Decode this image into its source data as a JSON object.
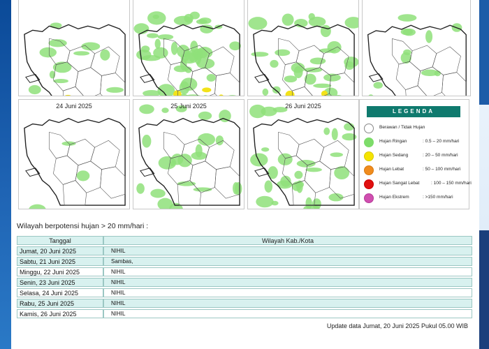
{
  "maps": [
    {
      "id": "map-1",
      "title": ""
    },
    {
      "id": "map-2",
      "title": ""
    },
    {
      "id": "map-3",
      "title": ""
    },
    {
      "id": "map-4",
      "title": ""
    },
    {
      "id": "map-5",
      "title": "24 Juni 2025"
    },
    {
      "id": "map-6",
      "title": "25 Juni 2025"
    },
    {
      "id": "map-7",
      "title": "26 Juni 2025"
    }
  ],
  "legend": {
    "title": "LEGENDA",
    "items": [
      {
        "label": "Berawan / Tidak Hujan",
        "range": "",
        "color": "#ffffff"
      },
      {
        "label": "Hujan Ringan",
        "range": ": 0.5 – 20 mm/hari",
        "color": "#7ddc6a"
      },
      {
        "label": "Hujan Sedang",
        "range": ": 20 – 50 mm/hari",
        "color": "#f5e400"
      },
      {
        "label": "Hujan Lebat",
        "range": ": 50 – 100 mm/hari",
        "color": "#f08c1e"
      },
      {
        "label": "Hujan Sangat Lebat",
        "range": ": 100 – 150 mm/hari",
        "color": "#e01010"
      },
      {
        "label": "Hujan Ekstrem",
        "range": ": >150 mm/hari",
        "color": "#d04fb0"
      }
    ]
  },
  "caption": "Wilayah berpotensi hujan > 20 mm/hari :",
  "table": {
    "headers": [
      "Tanggal",
      "Wilayah Kab./Kota"
    ],
    "rows": [
      [
        "Jumat, 20 Juni 2025",
        "NIHIL"
      ],
      [
        "Sabtu, 21 Juni 2025",
        "Sambas,"
      ],
      [
        "Minggu, 22 Juni 2025",
        "NIHIL"
      ],
      [
        "Senin, 23 Juni 2025",
        "NIHIL"
      ],
      [
        "Selasa, 24 Juni 2025",
        "NIHIL"
      ],
      [
        "Rabu, 25 Juni 2025",
        "NIHIL"
      ],
      [
        "Kamis, 26 Juni 2025",
        "NIHIL"
      ]
    ]
  },
  "update_text": "Update data Jumat, 20 Juni 2025 Pukul 05.00 WIB",
  "colors": {
    "accent": "#0f7a6e",
    "rain_light": "#7ddc6a",
    "rain_moderate": "#f5e400",
    "table_row": "#d8f1ef",
    "brand_blue": "#1f64b4"
  }
}
